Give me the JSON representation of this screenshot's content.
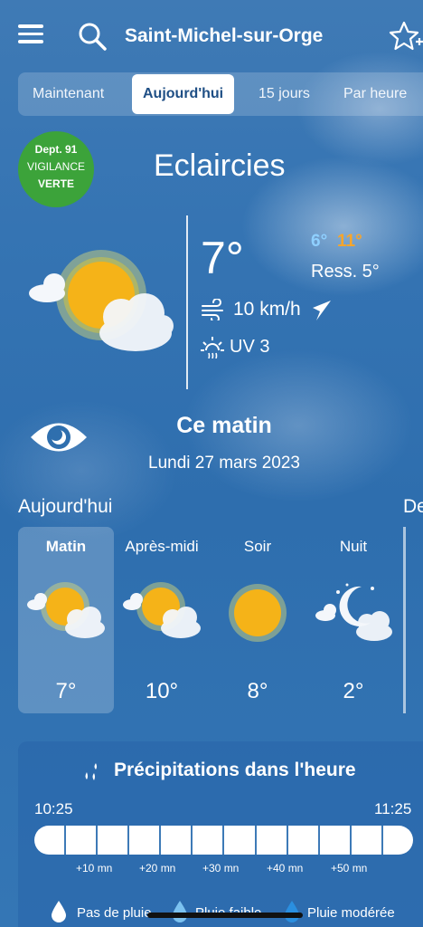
{
  "header": {
    "menu_icon": "hamburger-menu-icon",
    "search_icon": "search-icon",
    "city": "Saint-Michel-sur-Orge",
    "favorite_icon": "star-add-icon"
  },
  "tabs": [
    {
      "label": "Maintenant",
      "active": false
    },
    {
      "label": "Aujourd'hui",
      "active": true
    },
    {
      "label": "15 jours",
      "active": false
    },
    {
      "label": "Par heure",
      "active": false
    }
  ],
  "vigilance": {
    "line1": "Dept. 91",
    "line2": "VIGILANCE",
    "line3": "VERTE",
    "color": "#3ca33a"
  },
  "current": {
    "condition": "Eclaircies",
    "temperature": "7°",
    "temp_min": "6°",
    "temp_max": "11°",
    "feels_like": "Ress. 5°",
    "wind": "10 km/h",
    "uv": "UV 3",
    "weather_icon": "sun-behind-cloud-icon",
    "min_color": "#8fd0ff",
    "max_color": "#f7a52b"
  },
  "period": {
    "icon": "eye-icon",
    "title": "Ce matin",
    "date": "Lundi 27 mars 2023"
  },
  "day": {
    "label": "Aujourd'hui",
    "next_label": "De",
    "slots": [
      {
        "name": "Matin",
        "temp": "7°",
        "icon": "sun-behind-cloud-icon",
        "selected": true
      },
      {
        "name": "Après-midi",
        "temp": "10°",
        "icon": "sun-behind-cloud-icon",
        "selected": false
      },
      {
        "name": "Soir",
        "temp": "8°",
        "icon": "sun-icon",
        "selected": false
      },
      {
        "name": "Nuit",
        "temp": "2°",
        "icon": "moon-cloud-icon",
        "selected": false
      }
    ]
  },
  "precipitation": {
    "title": "Précipitations dans l'heure",
    "start_time": "10:25",
    "end_time": "11:25",
    "ticks": [
      "+10 mn",
      "+20 mn",
      "+30 mn",
      "+40 mn",
      "+50 mn"
    ],
    "legend": [
      {
        "label": "Pas de pluie",
        "icon": "drop-white-icon"
      },
      {
        "label": "Pluie faible",
        "icon": "drop-light-blue-icon"
      },
      {
        "label": "Pluie modérée",
        "icon": "drop-blue-icon"
      }
    ]
  }
}
